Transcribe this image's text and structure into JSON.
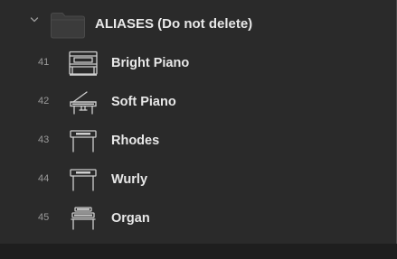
{
  "folder": {
    "label": "ALIASES (Do not delete)",
    "icon": "folder-icon",
    "expanded": true
  },
  "items": [
    {
      "number": "41",
      "label": "Bright Piano",
      "icon": "upright-piano-icon"
    },
    {
      "number": "42",
      "label": "Soft Piano",
      "icon": "grand-piano-icon"
    },
    {
      "number": "43",
      "label": "Rhodes",
      "icon": "electric-piano-icon"
    },
    {
      "number": "44",
      "label": "Wurly",
      "icon": "electric-piano-icon"
    },
    {
      "number": "45",
      "label": "Organ",
      "icon": "organ-icon"
    }
  ],
  "colors": {
    "background": "#2a2a2a",
    "text": "#e8e8e8",
    "number": "#9a9a9a",
    "folder": "#3a3a3a"
  }
}
